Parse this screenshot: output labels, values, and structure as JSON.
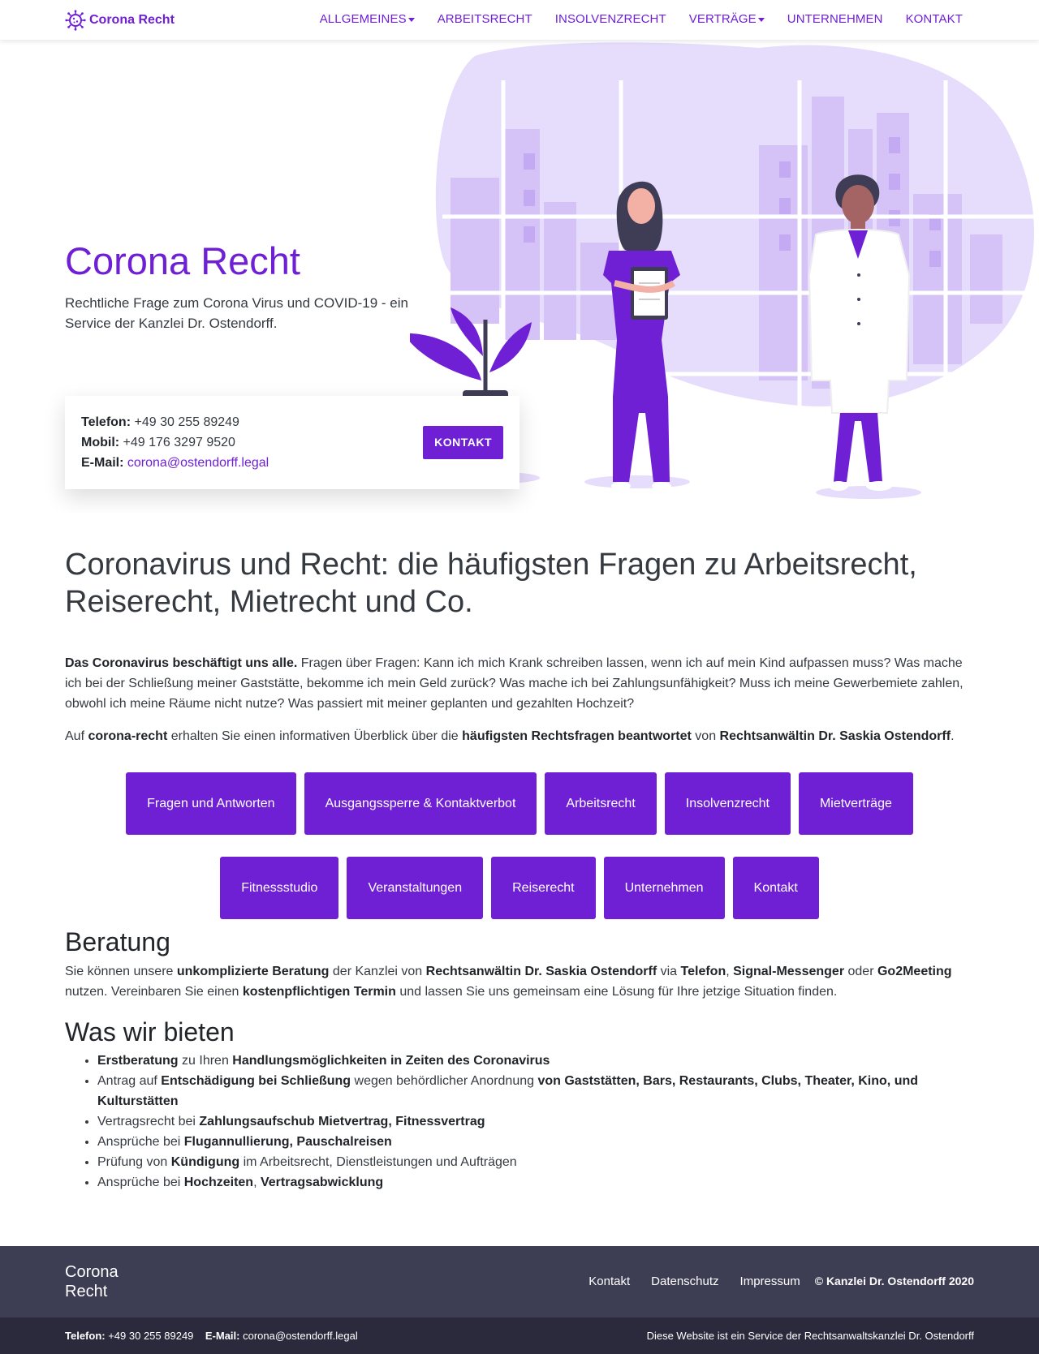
{
  "colors": {
    "primary": "#6f1fd4",
    "footer": "#3d3d54",
    "subfooter": "#2a2a3c"
  },
  "navbar": {
    "brand": "Corona Recht",
    "items": [
      {
        "label": "ALLGEMEINES",
        "dropdown": true
      },
      {
        "label": "ARBEITSRECHT",
        "dropdown": false
      },
      {
        "label": "INSOLVENZRECHT",
        "dropdown": false
      },
      {
        "label": "VERTRÄGE",
        "dropdown": true
      },
      {
        "label": "UNTERNEHMEN",
        "dropdown": false
      },
      {
        "label": "KONTAKT",
        "dropdown": false
      }
    ]
  },
  "hero": {
    "title": "Corona Recht",
    "subtitle": "Rechtliche Frage zum Corona Virus und COVID-19 - ein Service der Kanzlei Dr. Ostendorff.",
    "contact": {
      "phone_label": "Telefon:",
      "phone": "+49 30 255 89249",
      "mobile_label": "Mobil:",
      "mobile": "+49 176 3297 9520",
      "email_label": "E-Mail:",
      "email": "corona@ostendorff.legal",
      "button": "KONTAKT"
    }
  },
  "main": {
    "heading": "Coronavirus und Recht: die häufigsten Fragen zu Arbeitsrecht, Reiserecht, Mietrecht und Co.",
    "intro_bold": "Das Coronavirus beschäftigt uns alle.",
    "intro_text": " Fragen über Fragen: Kann ich mich Krank schreiben lassen, wenn ich auf mein Kind aufpassen muss? Was mache ich bei der Schließung meiner Gaststätte, bekomme ich mein Geld zurück? Was mache ich bei Zahlungsunfähigkeit? Muss ich meine Gewerbemiete zahlen, obwohl ich meine Räume nicht nutze? Was passiert mit meiner geplanten und gezahlten Hochzeit?",
    "intro2": {
      "t1": "Auf ",
      "b1": "corona-recht",
      "t2": " erhalten Sie einen informativen Überblick über die ",
      "b2": "häufigsten Rechtsfragen beantwortet",
      "t3": " von ",
      "b3": "Rechtsanwältin Dr. Saskia Ostendorff",
      "t4": "."
    },
    "topic_buttons_row1": [
      "Fragen und Antworten",
      "Ausgangssperre & Kontaktverbot",
      "Arbeitsrecht",
      "Insolvenzrecht",
      "Mietverträge"
    ],
    "topic_buttons_row2": [
      "Fitnessstudio",
      "Veranstaltungen",
      "Reiserecht",
      "Unternehmen",
      "Kontakt"
    ],
    "beratung": {
      "heading": "Beratung",
      "t1": "Sie können unsere ",
      "b1": "unkomplizierte Beratung",
      "t2": " der Kanzlei von ",
      "b2": "Rechtsanwältin Dr. Saskia Ostendorff",
      "t3": " via ",
      "b3": "Telefon",
      "t4": ", ",
      "b4": "Signal-Messenger",
      "t5": " oder ",
      "b5": "Go2Meeting",
      "t6": " nutzen. Vereinbaren Sie einen ",
      "b6": "kostenpflichtigen Termin",
      "t7": " und lassen Sie uns gemeinsam eine Lösung für Ihre jetzige Situation finden."
    },
    "bieten": {
      "heading": "Was wir bieten",
      "items": [
        {
          "b1": "Erstberatung",
          "t1": " zu Ihren ",
          "b2": "Handlungsmöglichkeiten in Zeiten des Coronavirus"
        },
        {
          "t0": "Antrag auf ",
          "b1": "Entschädigung bei Schließung",
          "t1": " wegen behördlicher Anordnung ",
          "b2": "von Gaststätten, Bars, Restaurants, Clubs, Theater, Kino, und Kulturstätten"
        },
        {
          "t0": "Vertragsrecht bei ",
          "b1": "Zahlungsaufschub Mietvertrag, Fitnessvertrag"
        },
        {
          "t0": "Ansprüche bei ",
          "b1": "Flugannullierung, Pauschalreisen"
        },
        {
          "t0": "Prüfung von ",
          "b1": "Kündigung",
          "t1": " im Arbeitsrecht, Dienstleistungen und Aufträgen"
        },
        {
          "t0": "Ansprüche bei ",
          "b1": "Hochzeiten",
          "t1": ", ",
          "b2": "Vertragsabwicklung"
        }
      ]
    }
  },
  "footer": {
    "brand_line1": "Corona",
    "brand_line2": "Recht",
    "links": [
      "Kontakt",
      "Datenschutz",
      "Impressum"
    ],
    "copyright": "© Kanzlei Dr. Ostendorff 2020"
  },
  "subfooter": {
    "phone_label": "Telefon:",
    "phone": "+49 30 255 89249",
    "email_label": "E-Mail:",
    "email": "corona@ostendorff.legal",
    "service": "Diese Website ist ein Service der Rechtsanwaltskanzlei Dr. Ostendorff"
  }
}
